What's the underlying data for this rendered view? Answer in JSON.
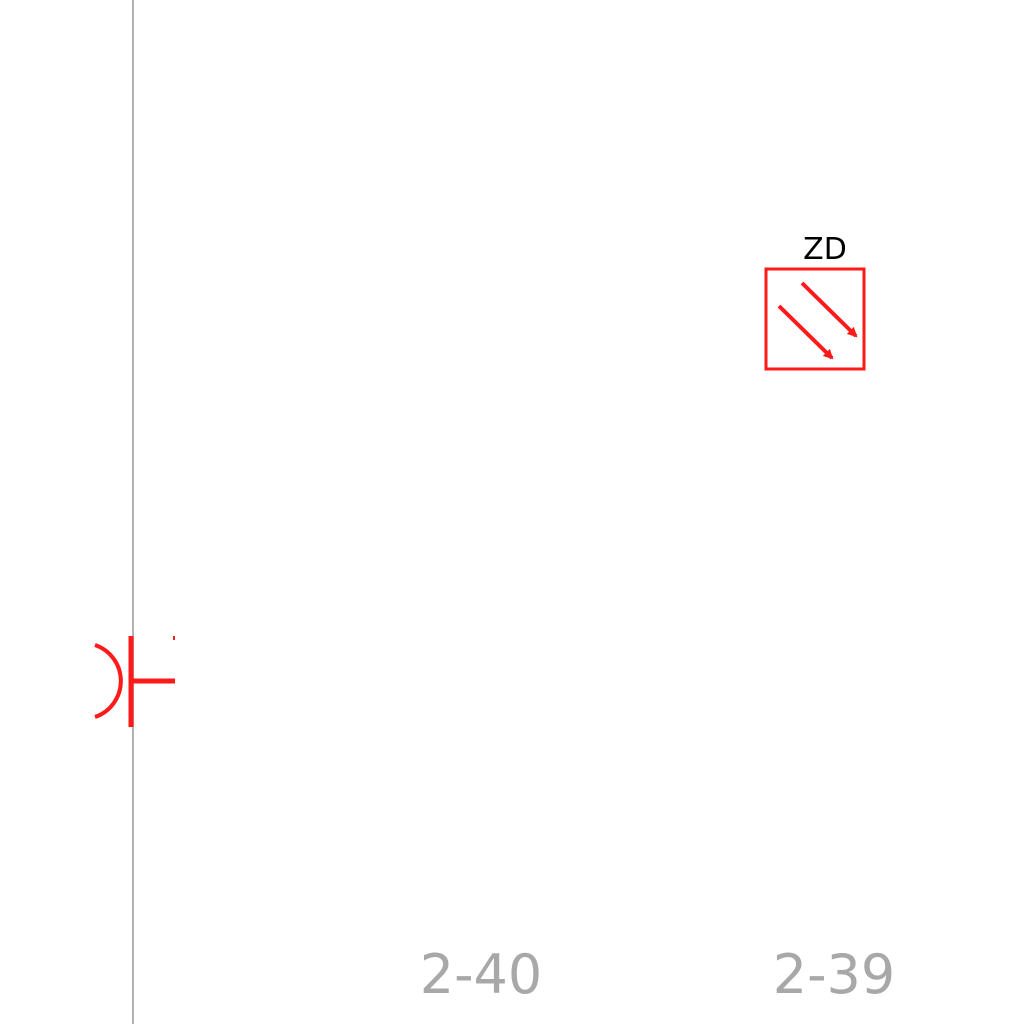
{
  "symbols": {
    "device": {
      "label": "ZD",
      "icon": "diagonal-double-arrow-icon",
      "color": "#ff1a1a"
    },
    "wall_outlet": {
      "icon": "outlet-arc-icon",
      "color": "#ff1a1a"
    }
  },
  "grid_labels": {
    "left": "2-40",
    "right": "2-39",
    "color": "#a8a8a8"
  },
  "wall_line_color": "#b3b3b3"
}
